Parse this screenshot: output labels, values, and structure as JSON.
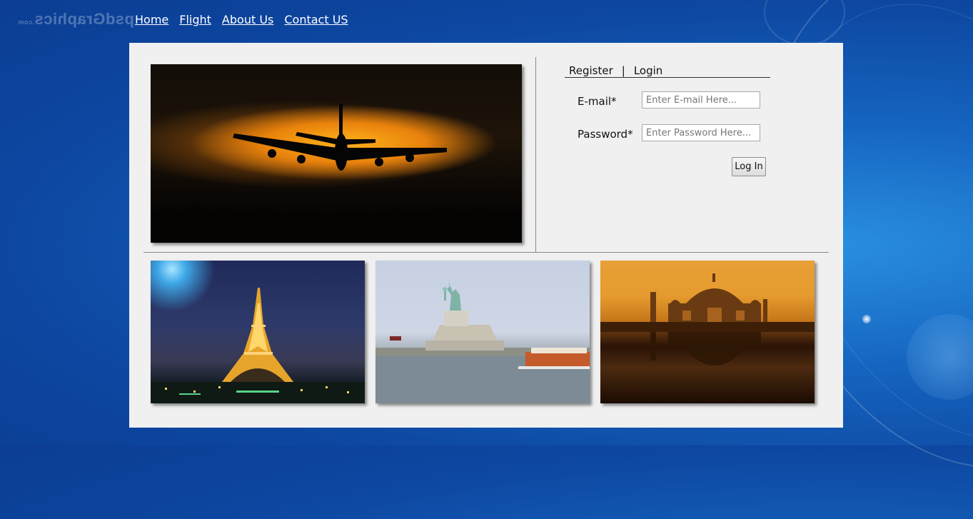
{
  "logo": {
    "text": "psdGraphics",
    "suffix": ".com"
  },
  "nav": {
    "items": [
      {
        "label": "Home"
      },
      {
        "label": "Flight"
      },
      {
        "label": "About Us"
      },
      {
        "label": "Contact US"
      }
    ]
  },
  "auth": {
    "tabs": {
      "register": "Register",
      "separator": "|",
      "login": "Login"
    },
    "email": {
      "label": "E-mail*",
      "placeholder": "Enter E-mail Here...",
      "value": ""
    },
    "password": {
      "label": "Password*",
      "placeholder": "Enter Password Here...",
      "value": ""
    },
    "submit_label": "Log In"
  },
  "gallery": {
    "images": [
      {
        "subject": "Eiffel Tower at night"
      },
      {
        "subject": "Statue of Liberty"
      },
      {
        "subject": "Taj Mahal at sunset"
      }
    ]
  },
  "colors": {
    "background": "#1565c0",
    "panel": "#f0f0f0",
    "nav_text": "#ffffff"
  }
}
